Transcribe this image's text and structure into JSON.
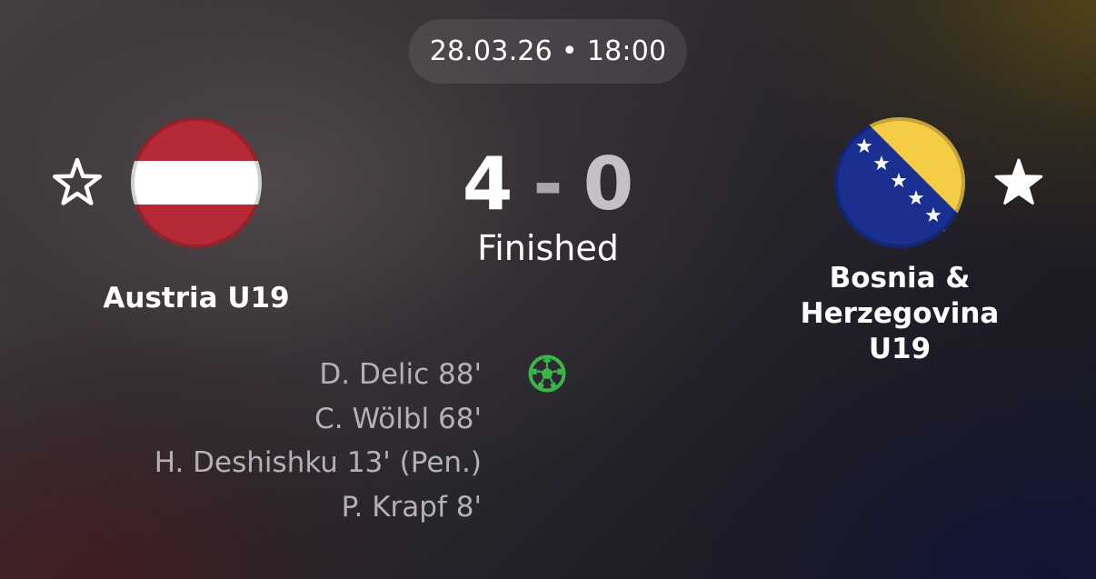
{
  "header": {
    "date": "28.03.26",
    "separator": "•",
    "time": "18:00"
  },
  "match": {
    "home": {
      "name": "Austria U19",
      "flag_icon": "austria-flag-icon",
      "favorited": false
    },
    "away": {
      "name_line1": "Bosnia & Herzegovina",
      "name_line2": "U19",
      "flag_icon": "bosnia-herzegovina-flag-icon",
      "favorited": true
    },
    "score": {
      "home": "4",
      "separator": "-",
      "away": "0"
    },
    "status": "Finished"
  },
  "goals": {
    "icon": "soccer-ball-icon",
    "home_scorers": [
      "D. Delic 88'",
      "C. Wölbl 68'",
      "H. Deshishku 13' (Pen.)",
      "P. Krapf 8'"
    ]
  },
  "colors": {
    "austria_red": "#C8102E",
    "bosnia_blue": "#002395",
    "bosnia_yellow": "#FECB00",
    "goal_green": "#3bb54a",
    "scorer_text": "#b4b1b6"
  }
}
